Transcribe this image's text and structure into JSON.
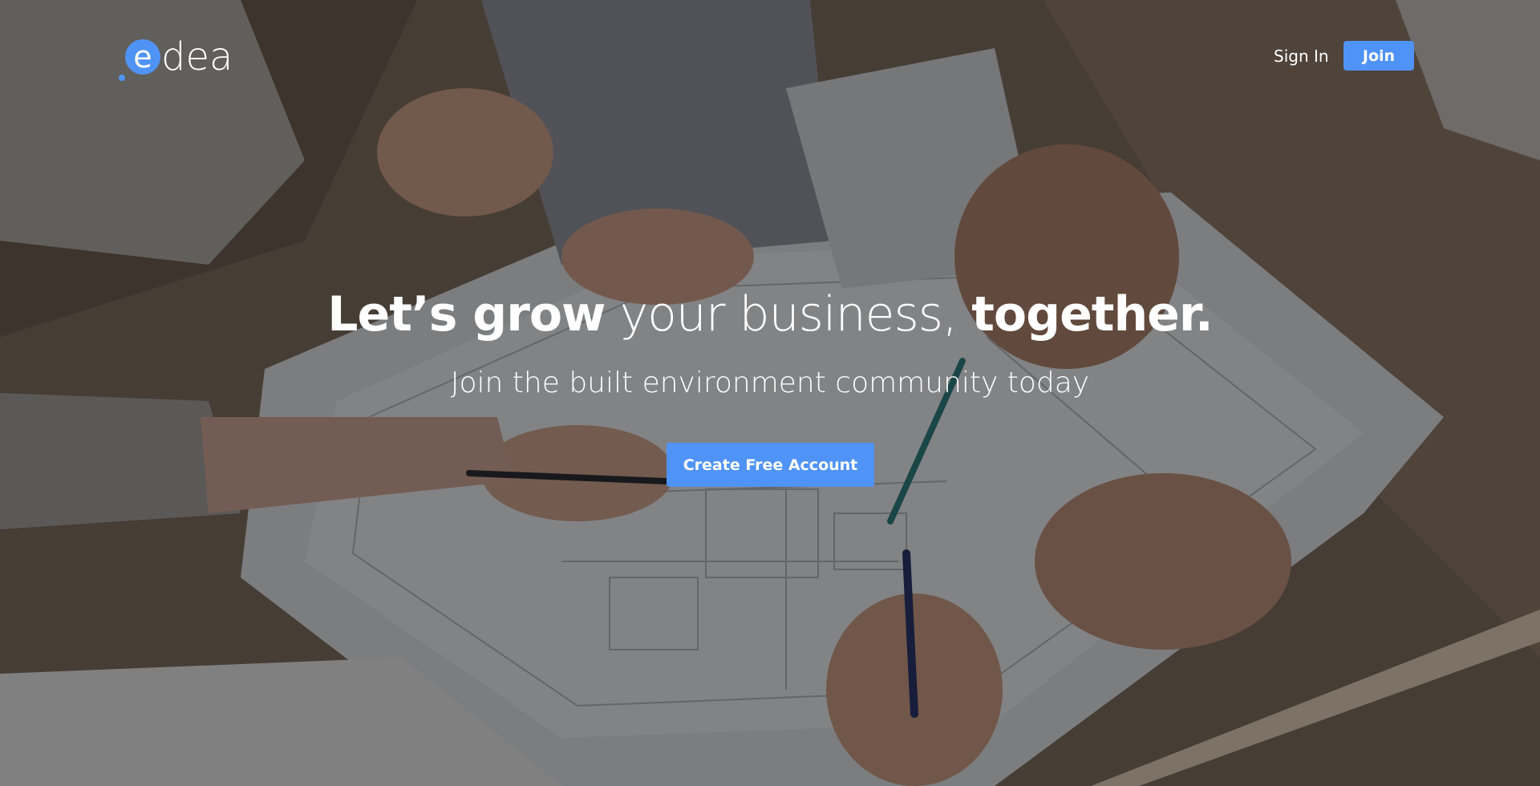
{
  "brand": {
    "logo_text": "edea",
    "accent_color": "#4f93f7"
  },
  "nav": {
    "sign_in_label": "Sign In",
    "join_label": "Join"
  },
  "hero": {
    "headline_part1": "Let’s grow",
    "headline_part2": " your business, ",
    "headline_part3": "together.",
    "subheadline": "Join the built environment community today",
    "cta_label": "Create Free Account",
    "background_image": "blueprint-meeting-photo"
  }
}
